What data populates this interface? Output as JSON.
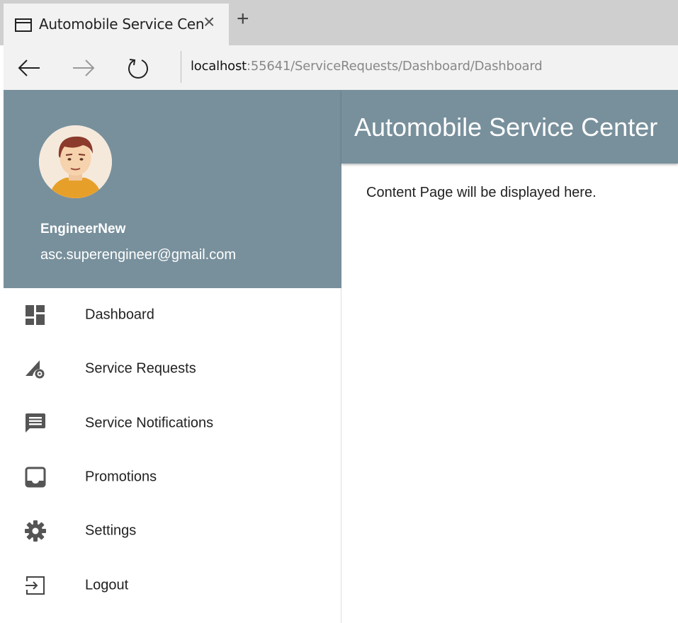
{
  "browser": {
    "tab_title": "Automobile Service Cen",
    "tab_close": "×",
    "new_tab": "+",
    "address_host": "localhost",
    "address_path": ":55641/ServiceRequests/Dashboard/Dashboard"
  },
  "profile": {
    "name": "EngineerNew",
    "email": "asc.superengineer@gmail.com"
  },
  "menu": {
    "items": [
      {
        "label": "Dashboard",
        "icon": "dashboard-icon"
      },
      {
        "label": "Service Requests",
        "icon": "service-requests-icon"
      },
      {
        "label": "Service Notifications",
        "icon": "chat-icon"
      },
      {
        "label": "Promotions",
        "icon": "inbox-icon"
      },
      {
        "label": "Settings",
        "icon": "gear-icon"
      },
      {
        "label": "Logout",
        "icon": "logout-icon"
      }
    ]
  },
  "header": {
    "title": "Automobile Service Center"
  },
  "content": {
    "text": "Content Page will be displayed here."
  },
  "colors": {
    "primary": "#78909c",
    "icon": "#555555"
  }
}
